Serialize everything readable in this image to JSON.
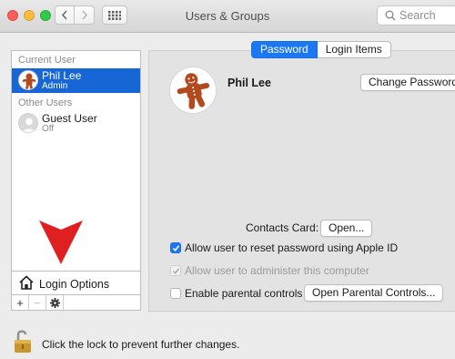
{
  "window": {
    "title": "Users & Groups",
    "search_placeholder": "Search"
  },
  "sidebar": {
    "current_user_label": "Current User",
    "other_users_label": "Other Users",
    "users": [
      {
        "name": "Phil Lee",
        "role": "Admin",
        "selected": true
      },
      {
        "name": "Guest User",
        "role": "Off",
        "selected": false
      }
    ],
    "login_options_label": "Login Options",
    "add_label": "+",
    "remove_label": "−"
  },
  "tabs": [
    {
      "label": "Password",
      "active": true
    },
    {
      "label": "Login Items",
      "active": false
    }
  ],
  "profile": {
    "name": "Phil Lee",
    "change_password_label": "Change Password..."
  },
  "contacts": {
    "label": "Contacts Card:",
    "open_label": "Open..."
  },
  "options": [
    {
      "label": "Allow user to reset password using Apple ID",
      "checked": true,
      "enabled": true
    },
    {
      "label": "Allow user to administer this computer",
      "checked": true,
      "enabled": false
    },
    {
      "label": "Enable parental controls",
      "checked": false,
      "enabled": true
    }
  ],
  "parental_button_label": "Open Parental Controls...",
  "lock_text": "Click the lock to prevent further changes.",
  "colors": {
    "selection": "#1766d6",
    "accent": "#1c78f2",
    "annotation_arrow": "#e02020"
  }
}
